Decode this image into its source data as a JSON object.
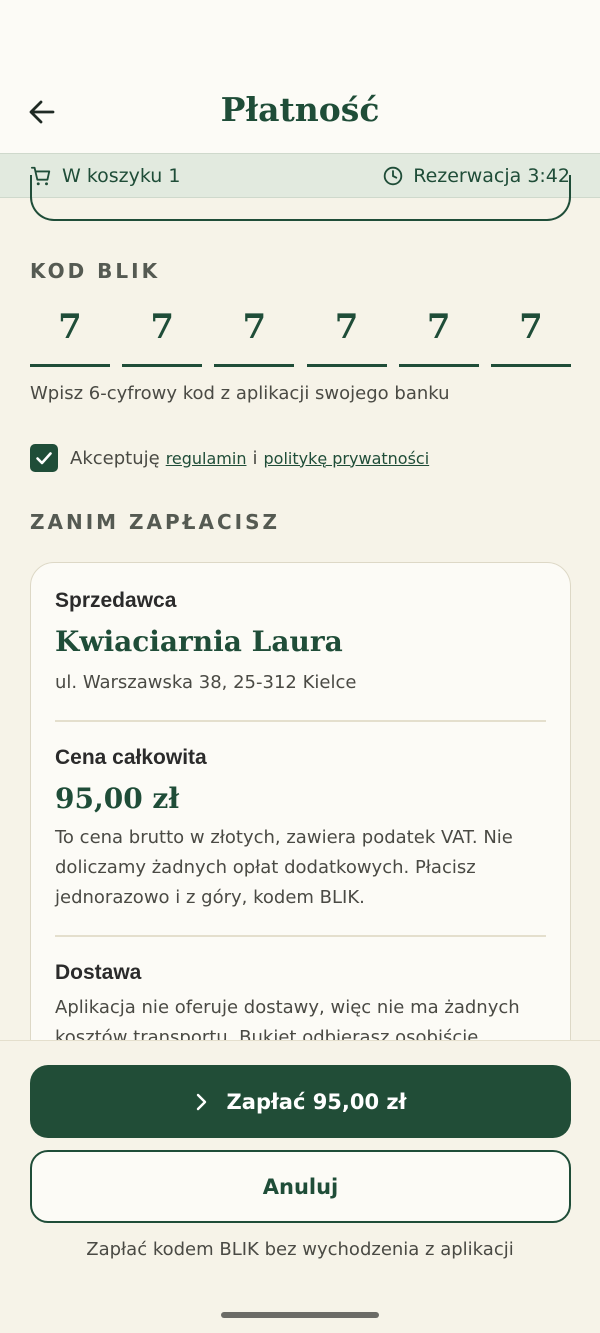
{
  "header": {
    "title": "Płatność"
  },
  "cart_bar": {
    "cart_label": "W koszyku 1",
    "reservation_label": "Rezerwacja 3:42"
  },
  "blik": {
    "section_label": "KOD BLIK",
    "digits": [
      "7",
      "7",
      "7",
      "7",
      "7",
      "7"
    ],
    "hint": "Wpisz 6-cyfrowy kod z aplikacji swojego banku"
  },
  "terms": {
    "checked": true,
    "prefix": "Akceptuję",
    "link_terms": "regulamin",
    "conjunction": "i",
    "link_privacy": "politykę prywatności"
  },
  "before_pay": {
    "section_label": "ZANIM ZAPŁACISZ",
    "seller_label": "Sprzedawca",
    "seller_name": "Kwiaciarnia Laura",
    "seller_address": "ul. Warszawska 38, 25-312 Kielce",
    "price_label": "Cena całkowita",
    "price_value": "95,00 zł",
    "price_desc": "To cena brutto w złotych, zawiera podatek VAT. Nie doliczamy żadnych opłat dodatkowych. Płacisz jednorazowo i z góry, kodem BLIK.",
    "delivery_label": "Dostawa",
    "delivery_desc": "Aplikacja nie oferuje dostawy, więc nie ma żadnych kosztów transportu. Bukiet odbierasz osobiście."
  },
  "actions": {
    "pay_label": "Zapłać 95,00 zł",
    "cancel_label": "Anuluj",
    "footnote": "Zapłać kodem BLIK bez wychodzenia z aplikacji"
  },
  "colors": {
    "accent": "#1f4d38",
    "background": "#f6f3e8",
    "card": "#fcfbf6"
  },
  "icons": {
    "back": "arrow-left-icon",
    "cart": "cart-icon",
    "clock": "clock-icon",
    "check": "check-icon",
    "chevron": "chevron-right-icon"
  }
}
